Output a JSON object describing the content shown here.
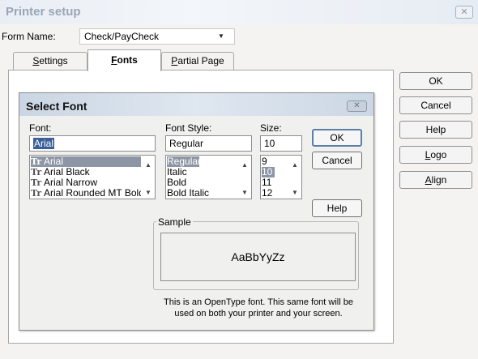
{
  "window": {
    "title": "Printer setup",
    "close_icon": "close-icon"
  },
  "form_name": {
    "label": "Form Name:",
    "value": "Check/PayCheck"
  },
  "tabs": [
    {
      "label": "Settings",
      "active": false
    },
    {
      "label": "Fonts",
      "active": true
    },
    {
      "label": "Partial Page",
      "active": false
    }
  ],
  "side_buttons": [
    "OK",
    "Cancel",
    "Help",
    "Logo",
    "Align"
  ],
  "dialog": {
    "title": "Select Font",
    "font": {
      "label": "Font:",
      "value": "Arial",
      "items": [
        "Arial",
        "Arial Black",
        "Arial Narrow",
        "Arial Rounded MT Bold"
      ],
      "selected_index": 0
    },
    "style": {
      "label": "Font Style:",
      "value": "Regular",
      "items": [
        "Regular",
        "Italic",
        "Bold",
        "Bold Italic"
      ],
      "selected_index": 0
    },
    "size": {
      "label": "Size:",
      "value": "10",
      "items": [
        "9",
        "10",
        "11",
        "12"
      ],
      "selected_index": 1
    },
    "buttons": {
      "ok": "OK",
      "cancel": "Cancel",
      "help": "Help"
    },
    "sample": {
      "label": "Sample",
      "text": "AaBbYyZz"
    },
    "note": "This is an OpenType font. This same font will be used on both your printer and your screen."
  }
}
